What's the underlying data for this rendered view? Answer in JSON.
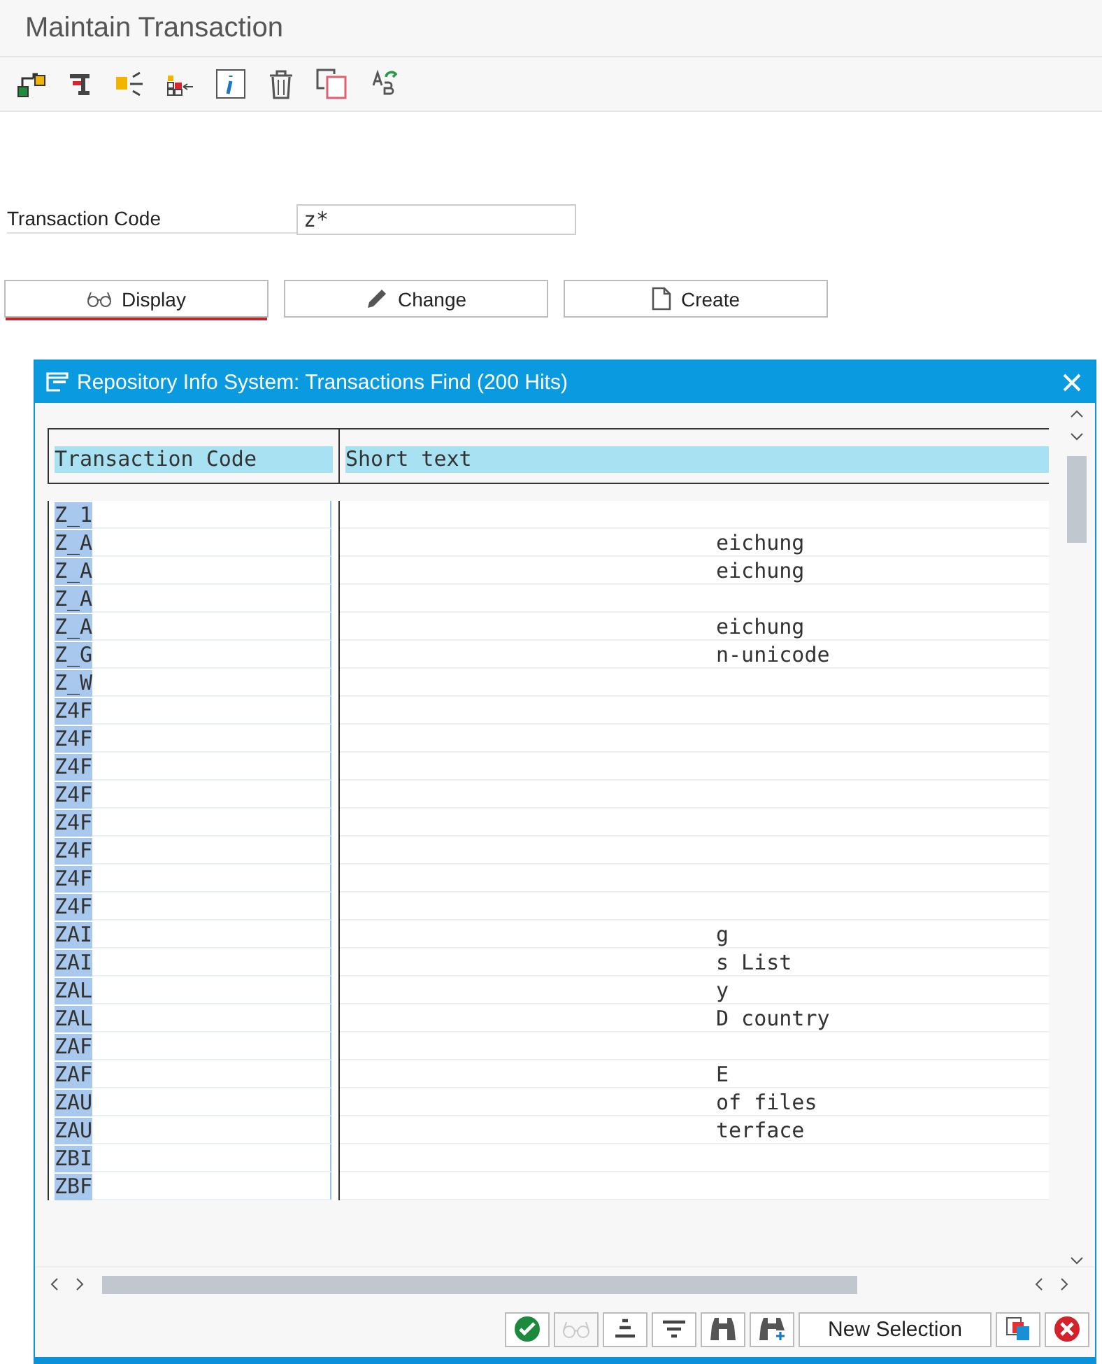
{
  "window": {
    "title": "Maintain Transaction"
  },
  "form": {
    "label": "Transaction Code",
    "value": "z*"
  },
  "buttons": [
    {
      "kind": "display",
      "label": "Display",
      "focused": true
    },
    {
      "kind": "change",
      "label": "Change",
      "focused": false
    },
    {
      "kind": "create",
      "label": "Create",
      "focused": false
    }
  ],
  "dialog": {
    "title": "Repository Info System: Transactions Find (200 Hits)",
    "columns": [
      "Transaction Code",
      "Short text"
    ],
    "rows": [
      {
        "code": "Z_1",
        "short_text": ""
      },
      {
        "code": "Z_A",
        "short_text": "eichung"
      },
      {
        "code": "Z_A",
        "short_text": "eichung"
      },
      {
        "code": "Z_A",
        "short_text": ""
      },
      {
        "code": "Z_A",
        "short_text": "eichung"
      },
      {
        "code": "Z_G",
        "short_text": "n-unicode"
      },
      {
        "code": "Z_W",
        "short_text": ""
      },
      {
        "code": "Z4F",
        "short_text": ""
      },
      {
        "code": "Z4F",
        "short_text": ""
      },
      {
        "code": "Z4F",
        "short_text": ""
      },
      {
        "code": "Z4F",
        "short_text": ""
      },
      {
        "code": "Z4F",
        "short_text": ""
      },
      {
        "code": "Z4F",
        "short_text": ""
      },
      {
        "code": "Z4F",
        "short_text": ""
      },
      {
        "code": "Z4F",
        "short_text": ""
      },
      {
        "code": "ZAI",
        "short_text": "g"
      },
      {
        "code": "ZAI",
        "short_text": "s List"
      },
      {
        "code": "ZAL",
        "short_text": "y"
      },
      {
        "code": "ZAL",
        "short_text": "D country"
      },
      {
        "code": "ZAF",
        "short_text": ""
      },
      {
        "code": "ZAF",
        "short_text": "E"
      },
      {
        "code": "ZAU",
        "short_text": "of files"
      },
      {
        "code": "ZAU",
        "short_text": "terface"
      },
      {
        "code": "ZBI",
        "short_text": ""
      },
      {
        "code": "ZBF",
        "short_text": ""
      }
    ],
    "footer_buttons": [
      {
        "kind": "ok",
        "disabled": false
      },
      {
        "kind": "display",
        "disabled": true
      },
      {
        "kind": "sort",
        "disabled": false
      },
      {
        "kind": "filter",
        "disabled": false
      },
      {
        "kind": "find",
        "disabled": false
      },
      {
        "kind": "find-next",
        "disabled": false
      },
      {
        "kind": "text",
        "label": "New Selection",
        "disabled": false
      },
      {
        "kind": "copy",
        "disabled": false
      },
      {
        "kind": "cancel",
        "disabled": false
      }
    ]
  }
}
